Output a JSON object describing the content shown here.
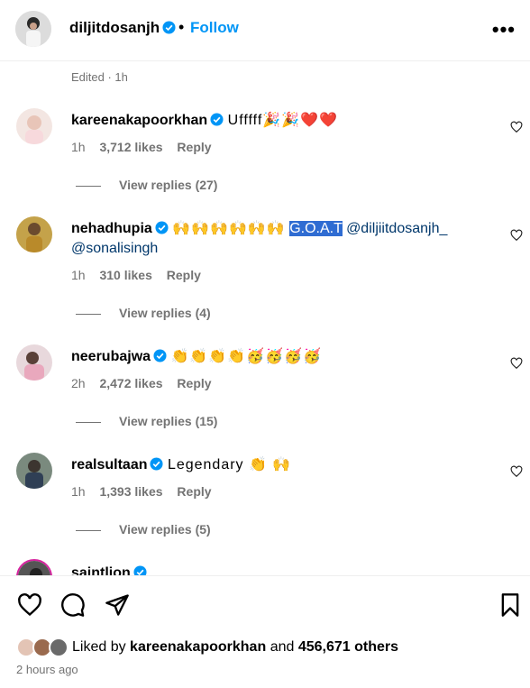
{
  "header": {
    "username": "diljitdosanjh",
    "dot": "•",
    "follow_label": "Follow",
    "more_label": "•••"
  },
  "caption": {
    "edited": "Edited · 1h"
  },
  "comments": [
    {
      "username": "kareenakapoorkhan",
      "text": "Ufffff🎉🎉❤️❤️",
      "age": "1h",
      "likes": "3,712 likes",
      "reply": "Reply",
      "view_replies": "View replies (27)"
    },
    {
      "username": "nehadhupia",
      "emoji": "🙌🙌🙌🙌🙌🙌",
      "highlighted": "G.O.A.T",
      "mention1": "@diljiitdosanjh_",
      "mention2": "@sonalisingh",
      "age": "1h",
      "likes": "310 likes",
      "reply": "Reply",
      "view_replies": "View replies (4)"
    },
    {
      "username": "neerubajwa",
      "text": "👏👏👏👏🥳🥳🥳🥳",
      "age": "2h",
      "likes": "2,472 likes",
      "reply": "Reply",
      "view_replies": "View replies (15)"
    },
    {
      "username": "realsultaan",
      "text": "Legendary 👏 🙌",
      "age": "1h",
      "likes": "1,393 likes",
      "reply": "Reply",
      "view_replies": "View replies (5)"
    },
    {
      "username": "saintlion"
    }
  ],
  "footer": {
    "liked_by_prefix": "Liked by",
    "liked_by_user": "kareenakapoorkhan",
    "liked_by_and": "and",
    "others": "456,671 others",
    "time": "2 hours ago"
  },
  "colors": {
    "link": "#0095f6",
    "verified": "#0095f6",
    "mention": "#00376b",
    "muted": "#737373",
    "highlight": "#2f6cd2"
  }
}
